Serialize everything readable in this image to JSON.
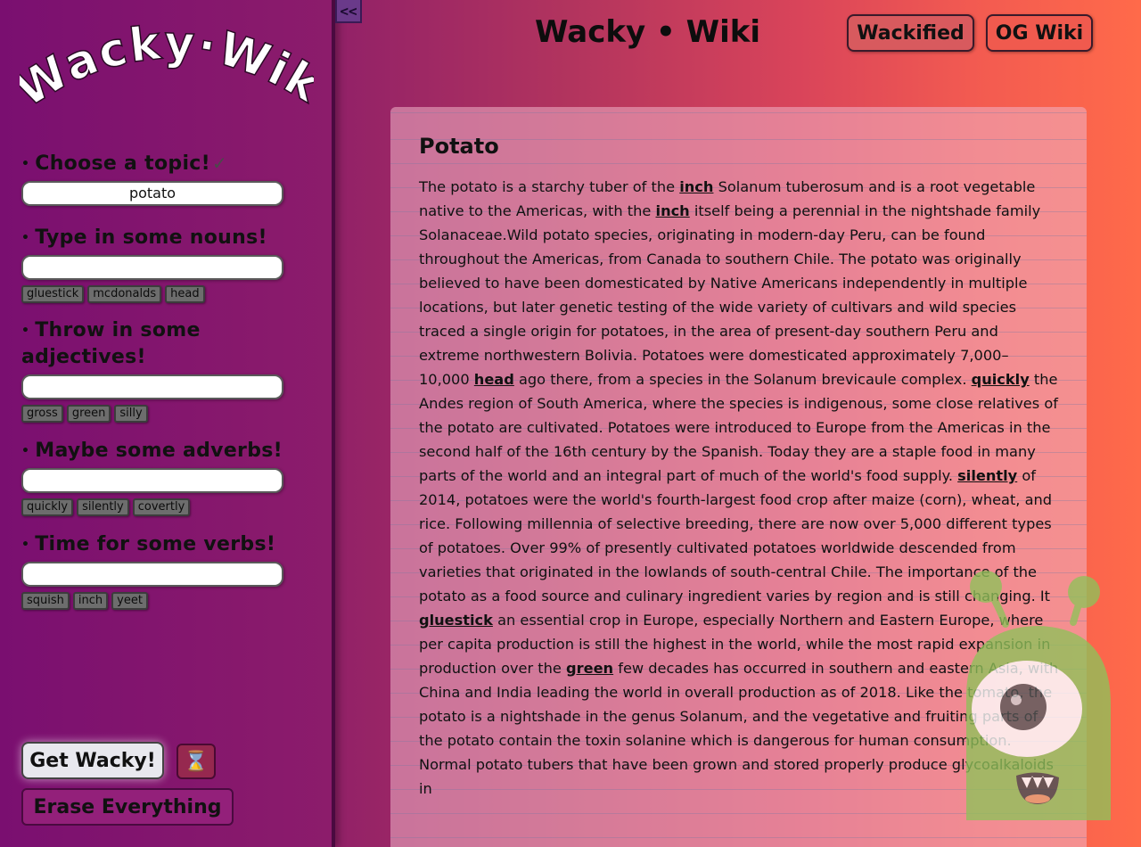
{
  "sidebar": {
    "logo_text": "Wacky·Wiki",
    "collapse_label": "<<",
    "topic": {
      "label": "Choose a topic!",
      "check": "✓",
      "value": "potato"
    },
    "nouns": {
      "label": "Type in some nouns!",
      "value": "",
      "chips": [
        "gluestick",
        "mcdonalds",
        "head"
      ]
    },
    "adjectives": {
      "label": "Throw in some adjectives!",
      "value": "",
      "chips": [
        "gross",
        "green",
        "silly"
      ]
    },
    "adverbs": {
      "label": "Maybe some adverbs!",
      "value": "",
      "chips": [
        "quickly",
        "silently",
        "covertly"
      ]
    },
    "verbs": {
      "label": "Time for some verbs!",
      "value": "",
      "chips": [
        "squish",
        "inch",
        "yeet"
      ]
    },
    "get_wacky_label": "Get Wacky!",
    "hourglass": "⌛",
    "erase_label": "Erase Everything"
  },
  "header": {
    "title": "Wacky • Wiki",
    "wackified_label": "Wackified",
    "og_label": "OG Wiki"
  },
  "article": {
    "title": "Potato",
    "segments": [
      {
        "t": "The potato is a starchy tuber of the "
      },
      {
        "t": "inch",
        "w": true
      },
      {
        "t": " Solanum tuberosum and is a root vegetable native to the Americas, with the "
      },
      {
        "t": "inch",
        "w": true
      },
      {
        "t": " itself being a perennial in the nightshade family Solanaceae.Wild potato species, originating in modern-day Peru, can be found throughout the Americas, from Canada to southern Chile. The potato was originally believed to have been domesticated by Native Americans independently in multiple locations, but later genetic testing of the wide variety of cultivars and wild species traced a single origin for potatoes, in the area of present-day southern Peru and extreme northwestern Bolivia. Potatoes were domesticated approximately 7,000–10,000 "
      },
      {
        "t": "head",
        "w": true
      },
      {
        "t": " ago there, from a species in the Solanum brevicaule complex. "
      },
      {
        "t": "quickly",
        "w": true
      },
      {
        "t": " the Andes region of South America, where the species is indigenous, some close relatives of the potato are cultivated. Potatoes were introduced to Europe from the Americas in the second half of the 16th century by the Spanish. Today they are a staple food in many parts of the world and an integral part of much of the world's food supply. "
      },
      {
        "t": "silently",
        "w": true
      },
      {
        "t": " of 2014, potatoes were the world's fourth-largest food crop after maize (corn), wheat, and rice. Following millennia of selective breeding, there are now over 5,000 different types of potatoes. Over 99% of presently cultivated potatoes worldwide descended from varieties that originated in the lowlands of south-central Chile. The importance of the potato as a food source and culinary ingredient varies by region and is still changing. It "
      },
      {
        "t": "gluestick",
        "w": true
      },
      {
        "t": " an essential crop in Europe, especially Northern and Eastern Europe, where per capita production is still the highest in the world, while the most rapid expansion in production over the "
      },
      {
        "t": "green",
        "w": true
      },
      {
        "t": " few decades has occurred in southern and eastern Asia, with China and India leading the world in overall production as of 2018. Like the tomato, the potato is a nightshade in the genus Solanum, and the vegetative and fruiting parts of the potato contain the toxin solanine which is dangerous for human consumption. Normal potato tubers that have been grown and stored properly produce glycoalkaloids in"
      }
    ]
  }
}
